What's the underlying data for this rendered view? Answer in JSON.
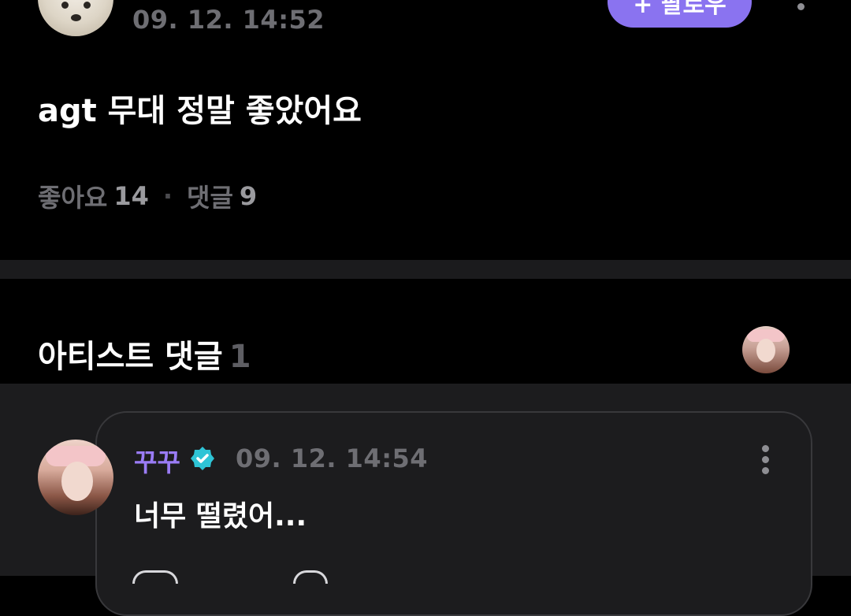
{
  "post": {
    "timestamp": "09. 12. 14:52",
    "follow_label": "+ 팔로우",
    "body": "agt 무대 정말 좋았어요",
    "likes_label": "좋아요",
    "likes_count": "14",
    "separator": "·",
    "comments_label": "댓글",
    "comments_count": "9"
  },
  "artist_comments": {
    "title": "아티스트 댓글",
    "count": "1"
  },
  "comment": {
    "author": "꾸꾸",
    "timestamp": "09. 12. 14:54",
    "text": "너무 떨렸어..."
  },
  "colors": {
    "background": "#000000",
    "accent": "#8a73f0",
    "author_name": "#9a7cf5",
    "verified_badge": "#2ec4d6",
    "muted_text": "#6e6e73",
    "card_background": "#1c1c1e"
  },
  "icons": {
    "post_more": "more-vertical-icon",
    "comment_more": "more-vertical-icon",
    "verified": "verified-badge-icon"
  }
}
